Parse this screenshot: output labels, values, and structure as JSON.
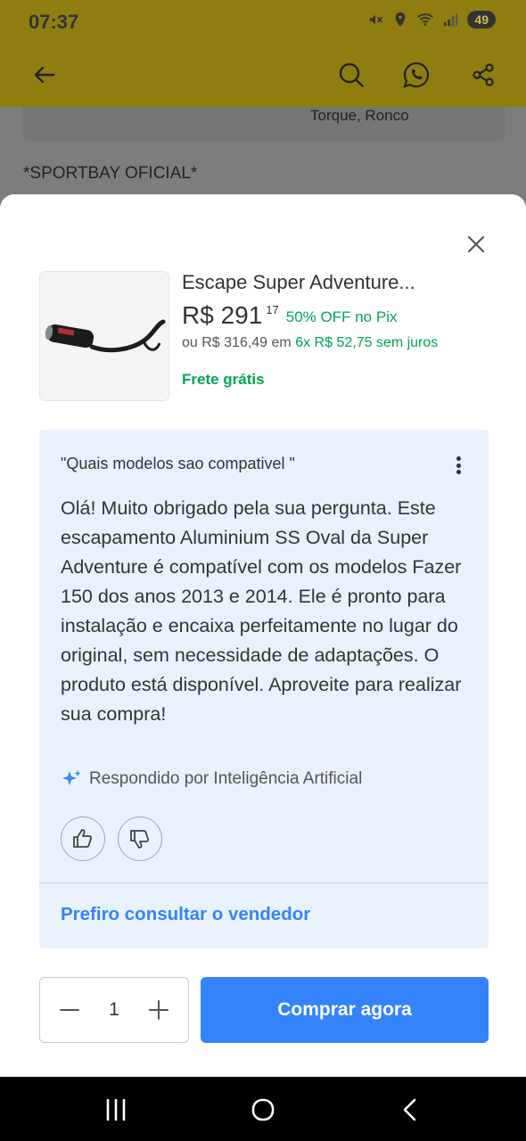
{
  "status_bar": {
    "time": "07:37",
    "battery": "49"
  },
  "app_bar": {
    "icons": [
      "back-arrow-icon",
      "search-icon",
      "whatsapp-icon",
      "share-icon"
    ]
  },
  "background": {
    "card_text": "Torque, Ronco",
    "seller": "*SPORTBAY OFICIAL*"
  },
  "product": {
    "title": "Escape Super Adventure...",
    "price_main": "R$ 291",
    "price_cents": "17",
    "discount": "50% OFF no Pix",
    "installments_prefix": "ou R$ 316,49 em ",
    "installments_highlight": "6x R$ 52,75 sem juros",
    "shipping": "Frete grátis"
  },
  "qa": {
    "question": "\"Quais modelos sao compativel \"",
    "answer": "Olá! Muito obrigado pela sua pergunta. Este escapamento Aluminium SS Oval da Super Adventure é compatível com os modelos Fazer 150 dos anos 2013 e 2014. Ele é pronto para instalação e encaixa perfeitamente no lugar do original, sem necessidade de adaptações. O produto está disponível. Aproveite para realizar sua compra!",
    "ai_label": "Respondido por Inteligência Artificial",
    "consult_seller": "Prefiro consultar o vendedor"
  },
  "purchase": {
    "quantity": "1",
    "buy_label": "Comprar agora"
  },
  "colors": {
    "brand_yellow_dimmed": "#8f7e0f",
    "accent_blue": "#3483fa",
    "green": "#00a650",
    "qa_background": "#e9f2fc"
  }
}
